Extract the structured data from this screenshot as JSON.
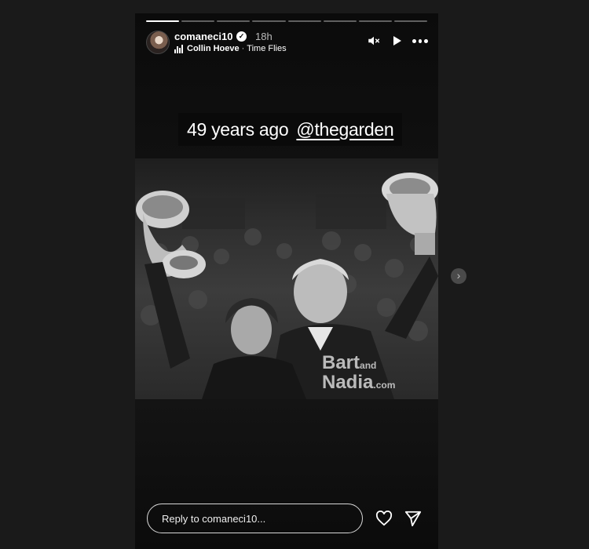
{
  "story": {
    "progress_segments": 8,
    "active_segment": 1
  },
  "header": {
    "username": "comaneci10",
    "time_ago": "18h",
    "verified_icon": "verified-badge-icon",
    "music": {
      "artist": "Collin Hoeve",
      "separator": "·",
      "title": "Time Flies"
    }
  },
  "caption": {
    "text": "49 years ago",
    "mention": "@thegarden"
  },
  "watermark": {
    "line1": "Bart",
    "line1_small": "and",
    "line2": "Nadia",
    "line2_small": ".com"
  },
  "reply": {
    "placeholder": "Reply to comaneci10..."
  },
  "icons": {
    "mute": "muted-speaker-icon",
    "play": "play-icon",
    "more": "more-options-icon",
    "heart": "heart-icon",
    "send": "send-icon",
    "next": "chevron-right-icon"
  },
  "colors": {
    "page_background": "#1a1a1a",
    "story_background": "#111111",
    "text": "#ffffff"
  }
}
